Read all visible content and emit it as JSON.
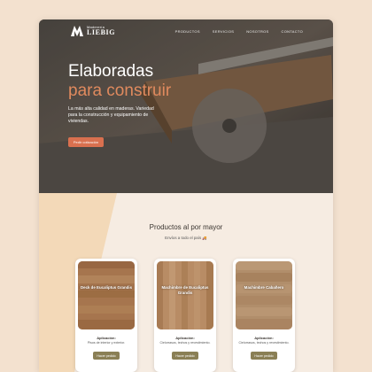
{
  "nav": {
    "logo_subtitle": "Maderería",
    "logo_name": "LIEBIG",
    "links": [
      "PRODUCTOS",
      "SERVICIOS",
      "NOSOTROS",
      "CONTACTO"
    ]
  },
  "hero": {
    "title_line1": "Elaboradas",
    "title_line2": "para construir",
    "description": "La más alta calidad en maderas. Variedad para la construcción y equipamiento de viviendas.",
    "cta_label": "Pedir cotización"
  },
  "products": {
    "title": "Productos al por mayor",
    "subtitle": "Envíos a todo el país 🚚",
    "cards": [
      {
        "name": "Deck de Eucaliptus Grandis",
        "app_title": "Aplicación:",
        "app_text": "Pisos de interior y exterior.",
        "button": "Hacer pedido"
      },
      {
        "name": "Machimbre de Eucaliptus Grandis",
        "app_title": "Aplicación:",
        "app_text": "Cielorrasos, techos y revestimiento.",
        "button": "Hacer pedido"
      },
      {
        "name": "Machimbre Cabañero",
        "app_title": "Aplicación:",
        "app_text": "Cielorrasos, techos y revestimiento.",
        "button": "Hacer pedido"
      }
    ]
  },
  "colors": {
    "accent": "#e08a5e",
    "cta": "#d9704f",
    "card_button": "#8a7f55",
    "background": "#f3e1cf"
  }
}
